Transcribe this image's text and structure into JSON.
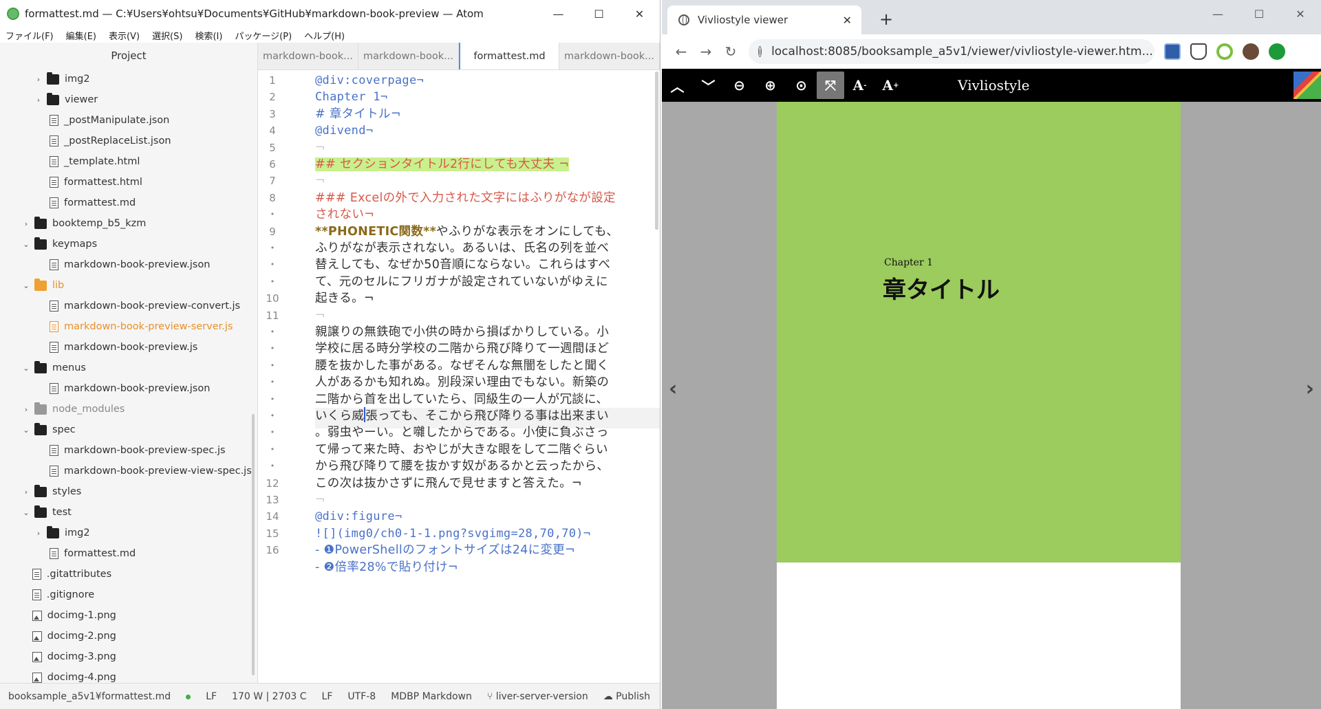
{
  "atom": {
    "title": "formattest.md — C:¥Users¥ohtsu¥Documents¥GitHub¥markdown-book-preview — Atom",
    "menu": [
      "ファイル(F)",
      "編集(E)",
      "表示(V)",
      "選択(S)",
      "検索(I)",
      "パッケージ(P)",
      "ヘルプ(H)"
    ],
    "tree_header": "Project",
    "tree": [
      {
        "label": "img2",
        "kind": "folder",
        "indent": 1,
        "chev": "›",
        "style": ""
      },
      {
        "label": "viewer",
        "kind": "folder",
        "indent": 1,
        "chev": "›",
        "style": ""
      },
      {
        "label": "_postManipulate.json",
        "kind": "file",
        "indent": 2,
        "chev": "",
        "style": ""
      },
      {
        "label": "_postReplaceList.json",
        "kind": "file",
        "indent": 2,
        "chev": "",
        "style": ""
      },
      {
        "label": "_template.html",
        "kind": "file",
        "indent": 2,
        "chev": "",
        "style": ""
      },
      {
        "label": "formattest.html",
        "kind": "file",
        "indent": 2,
        "chev": "",
        "style": ""
      },
      {
        "label": "formattest.md",
        "kind": "file",
        "indent": 2,
        "chev": "",
        "style": ""
      },
      {
        "label": "booktemp_b5_kzm",
        "kind": "folder",
        "indent": 0,
        "chev": "›",
        "style": ""
      },
      {
        "label": "keymaps",
        "kind": "folder",
        "indent": 0,
        "chev": "⌄",
        "style": ""
      },
      {
        "label": "markdown-book-preview.json",
        "kind": "file",
        "indent": 2,
        "chev": "",
        "style": ""
      },
      {
        "label": "lib",
        "kind": "folder",
        "indent": 0,
        "chev": "⌄",
        "style": "orange"
      },
      {
        "label": "markdown-book-preview-convert.js",
        "kind": "file",
        "indent": 2,
        "chev": "",
        "style": ""
      },
      {
        "label": "markdown-book-preview-server.js",
        "kind": "file",
        "indent": 2,
        "chev": "",
        "style": "orange"
      },
      {
        "label": "markdown-book-preview.js",
        "kind": "file",
        "indent": 2,
        "chev": "",
        "style": ""
      },
      {
        "label": "menus",
        "kind": "folder",
        "indent": 0,
        "chev": "⌄",
        "style": ""
      },
      {
        "label": "markdown-book-preview.json",
        "kind": "file",
        "indent": 2,
        "chev": "",
        "style": ""
      },
      {
        "label": "node_modules",
        "kind": "folder",
        "indent": 0,
        "chev": "›",
        "style": "gray"
      },
      {
        "label": "spec",
        "kind": "folder",
        "indent": 0,
        "chev": "⌄",
        "style": ""
      },
      {
        "label": "markdown-book-preview-spec.js",
        "kind": "file",
        "indent": 2,
        "chev": "",
        "style": ""
      },
      {
        "label": "markdown-book-preview-view-spec.js",
        "kind": "file",
        "indent": 2,
        "chev": "",
        "style": ""
      },
      {
        "label": "styles",
        "kind": "folder",
        "indent": 0,
        "chev": "›",
        "style": ""
      },
      {
        "label": "test",
        "kind": "folder",
        "indent": 0,
        "chev": "⌄",
        "style": ""
      },
      {
        "label": "img2",
        "kind": "folder",
        "indent": 1,
        "chev": "›",
        "style": ""
      },
      {
        "label": "formattest.md",
        "kind": "file",
        "indent": 2,
        "chev": "",
        "style": ""
      },
      {
        "label": ".gitattributes",
        "kind": "file",
        "indent": 0.6,
        "chev": "",
        "style": ""
      },
      {
        "label": ".gitignore",
        "kind": "file",
        "indent": 0.6,
        "chev": "",
        "style": ""
      },
      {
        "label": "docimg-1.png",
        "kind": "img",
        "indent": 0.6,
        "chev": "",
        "style": ""
      },
      {
        "label": "docimg-2.png",
        "kind": "img",
        "indent": 0.6,
        "chev": "",
        "style": ""
      },
      {
        "label": "docimg-3.png",
        "kind": "img",
        "indent": 0.6,
        "chev": "",
        "style": ""
      },
      {
        "label": "docimg-4.png",
        "kind": "img",
        "indent": 0.6,
        "chev": "",
        "style": ""
      }
    ],
    "tabs": [
      "markdown-book...",
      "markdown-book...",
      "formattest.md",
      "markdown-book..."
    ],
    "active_tab": 2,
    "gutter": [
      "1",
      "2",
      "3",
      "4",
      "5",
      "6",
      "7",
      "8",
      "•",
      "9",
      "•",
      "•",
      "•",
      "10",
      "11",
      "•",
      "•",
      "•",
      "•",
      "•",
      "•",
      "•",
      "•",
      "•",
      "12",
      "13",
      "14",
      "15",
      "16"
    ],
    "cursor_row": 20,
    "lines": [
      {
        "text": "@div:coverpage¬",
        "cls": "c-blue mono"
      },
      {
        "text": "Chapter 1¬",
        "cls": "c-blue mono"
      },
      {
        "text": "# 章タイトル¬",
        "cls": "c-blue"
      },
      {
        "text": "@divend¬",
        "cls": "c-blue mono"
      },
      {
        "text": "¬",
        "cls": "invis"
      },
      {
        "text": "## セクションタイトル2行にしても大丈夫       ¬",
        "cls": "c-red hl-line"
      },
      {
        "text": "¬",
        "cls": "invis"
      },
      {
        "text": "### Excelの外で入力された文字にはふりがなが設定",
        "cls": "c-red"
      },
      {
        "text": "されない¬",
        "cls": "c-red"
      },
      {
        "text": "**PHONETIC関数**やふりがな表示をオンにしても、",
        "cls": "mixed9"
      },
      {
        "text": "ふりがなが表示されない。あるいは、氏名の列を並べ",
        "cls": ""
      },
      {
        "text": "替えしても、なぜか50音順にならない。これらはすべ",
        "cls": ""
      },
      {
        "text": "て、元のセルにフリガナが設定されていないがゆえに",
        "cls": ""
      },
      {
        "text": "起きる。¬",
        "cls": ""
      },
      {
        "text": "¬",
        "cls": "invis"
      },
      {
        "text": "親譲りの無鉄砲で小供の時から損ばかりしている。小",
        "cls": ""
      },
      {
        "text": "学校に居る時分学校の二階から飛び降りて一週間ほど",
        "cls": ""
      },
      {
        "text": "腰を抜かした事がある。なぜそんな無闇をしたと聞く",
        "cls": ""
      },
      {
        "text": "人があるかも知れぬ。別段深い理由でもない。新築の",
        "cls": ""
      },
      {
        "text": "二階から首を出していたら、同級生の一人が冗談に、",
        "cls": ""
      },
      {
        "text": "いくら威張っても、そこから飛び降りる事は出来まい",
        "cls": "cursor"
      },
      {
        "text": "。弱虫やーい。と囃したからである。小使に負ぶさっ",
        "cls": ""
      },
      {
        "text": "て帰って来た時、おやじが大きな眼をして二階ぐらい",
        "cls": ""
      },
      {
        "text": "から飛び降りて腰を抜かす奴があるかと云ったから、",
        "cls": ""
      },
      {
        "text": "この次は抜かさずに飛んで見せますと答えた。¬",
        "cls": ""
      },
      {
        "text": "¬",
        "cls": "invis"
      },
      {
        "text": "@div:figure¬",
        "cls": "c-blue mono"
      },
      {
        "text": "![](img0/ch0-1-1.png?svgimg=28,70,70)¬",
        "cls": "c-blue mono"
      },
      {
        "text": "- ❶PowerShellのフォントサイズは24に変更¬",
        "cls": "c-blue"
      },
      {
        "text": "- ❷倍率28%で貼り付け¬",
        "cls": "c-blue"
      }
    ],
    "status": {
      "path": "booksample_a5v1¥formattest.md",
      "lf1": "LF",
      "count": "170 W | 2703 C",
      "lf2": "LF",
      "encoding": "UTF-8",
      "grammar": "MDBP Markdown",
      "branch": "liver-server-version",
      "publish": "Publish"
    }
  },
  "chrome": {
    "tab_title": "Vivliostyle viewer",
    "url": "localhost:8085/booksample_a5v1/viewer/vivliostyle-viewer.htm...",
    "viewer_title": "Vivliostyle",
    "chapter": "Chapter 1",
    "chapter_title": "章タイトル",
    "cover_color": "#9ccb5e"
  }
}
